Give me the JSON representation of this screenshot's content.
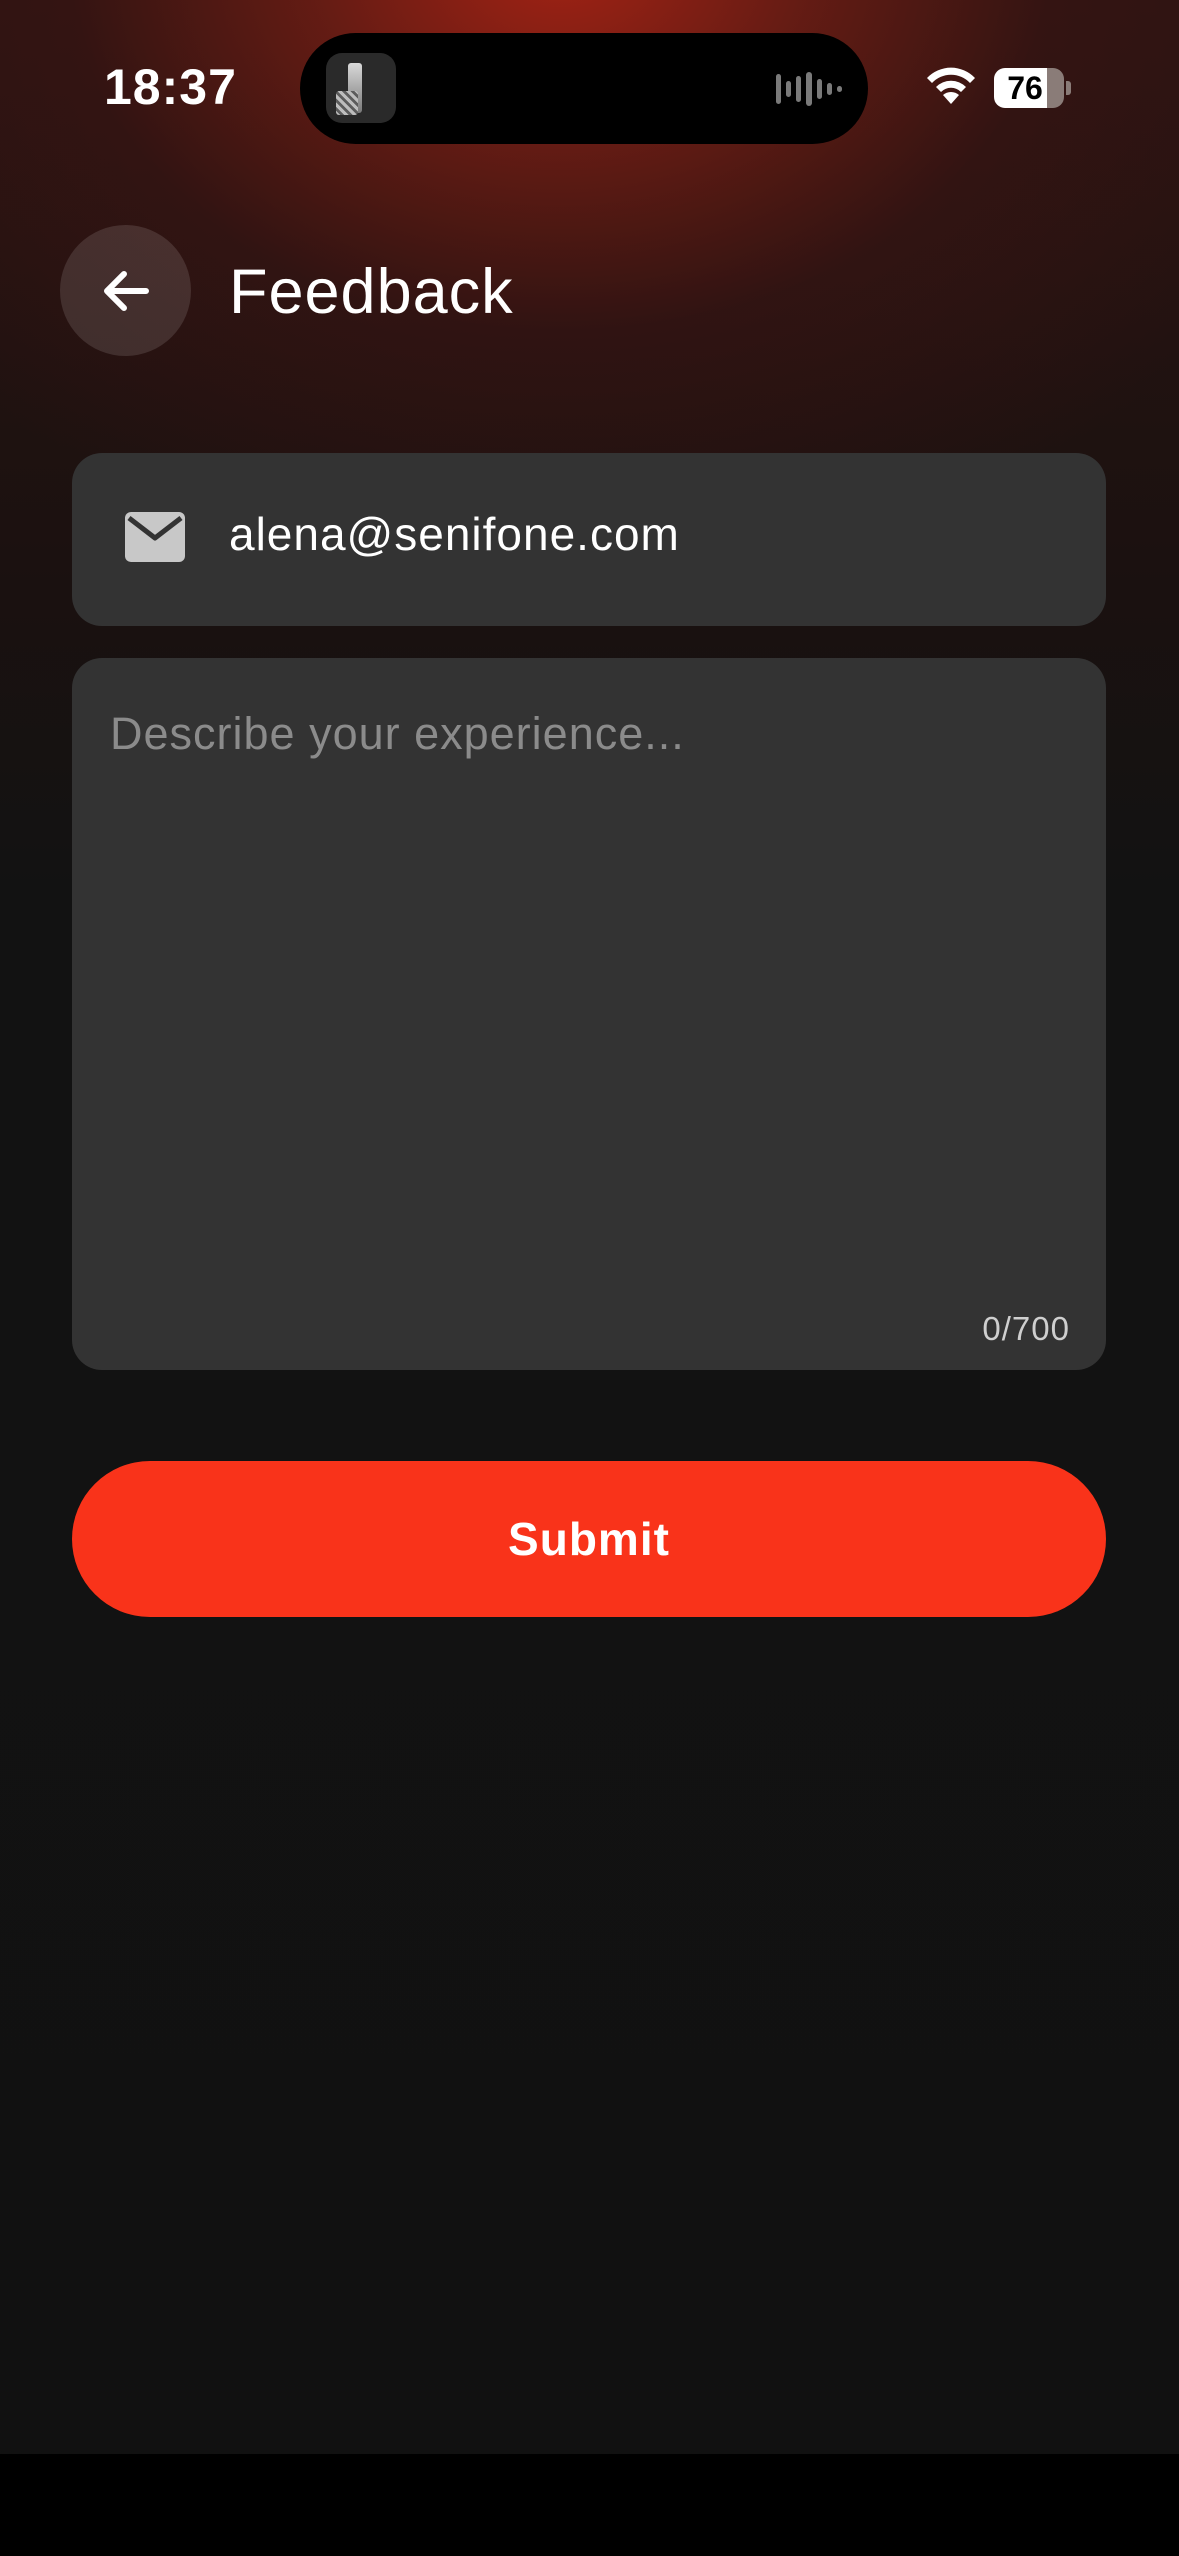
{
  "status_bar": {
    "time": "18:37",
    "battery": "76",
    "battery_level": 0.76
  },
  "header": {
    "title": "Feedback",
    "back_icon": "arrow-left-icon"
  },
  "form": {
    "email_icon": "mail-icon",
    "email_value": "alena@senifone.com",
    "feedback_placeholder": "Describe your experience...",
    "char_counter": "0/700",
    "submit_label": "Submit"
  },
  "colors": {
    "accent": "#f9331a",
    "field_bg": "#333333",
    "page_bg": "#111111"
  }
}
